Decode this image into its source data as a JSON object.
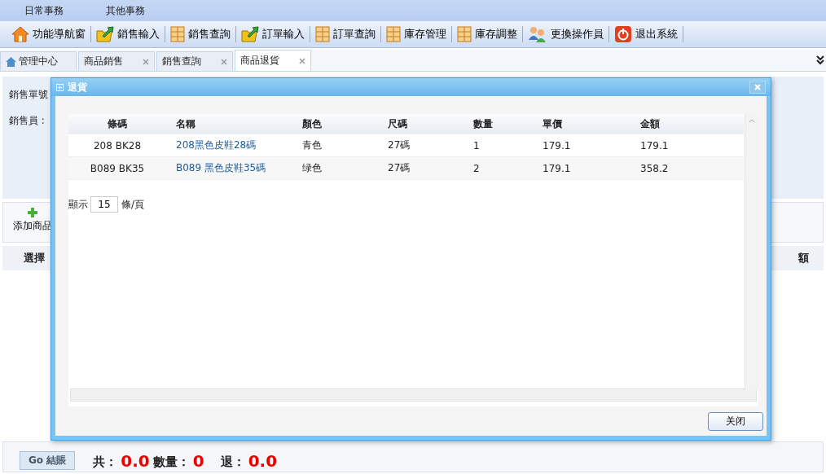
{
  "menu": [
    "日常事務",
    "其他事務"
  ],
  "toolbar": [
    {
      "label": "功能導航窗",
      "kind": "home"
    },
    {
      "label": "銷售輸入",
      "kind": "folder"
    },
    {
      "label": "銷售查詢",
      "kind": "grid"
    },
    {
      "label": "訂單輸入",
      "kind": "folder"
    },
    {
      "label": "訂單查詢",
      "kind": "grid"
    },
    {
      "label": "庫存管理",
      "kind": "grid"
    },
    {
      "label": "庫存調整",
      "kind": "grid"
    },
    {
      "label": "更換操作員",
      "kind": "users"
    },
    {
      "label": "退出系統",
      "kind": "power"
    }
  ],
  "tabs": [
    {
      "label": "管理中心",
      "kind": "home",
      "selected": false
    },
    {
      "label": "商品銷售",
      "kind": "closable",
      "selected": false
    },
    {
      "label": "銷售查詢",
      "kind": "closable",
      "selected": false
    },
    {
      "label": "商品退貨",
      "kind": "closable",
      "selected": true
    }
  ],
  "page": {
    "order_label": "銷售單號",
    "seller_label": "銷售員 :",
    "add_button": "添加商品",
    "col_first": "選擇",
    "col_last": "額",
    "checkout_button": "Go 結賬",
    "total_label": "共：",
    "total": "0.0",
    "qty_label": "數量：",
    "qty": "0",
    "return_label": "退：",
    "return_total": "0.0"
  },
  "dialog": {
    "title": "退貨",
    "columns": [
      "條碼",
      "名稱",
      "顏色",
      "尺碼",
      "數量",
      "單價",
      "金額"
    ],
    "rows": [
      [
        "208 BK28",
        "208黑色皮鞋28碼",
        "青色",
        "27碼",
        "1",
        "179.1",
        "179.1"
      ],
      [
        "B089 BK35",
        "B089 黑色皮鞋35碼",
        "绿色",
        "27碼",
        "2",
        "179.1",
        "358.2"
      ]
    ],
    "page_size_label": "顯示",
    "page_size": "15",
    "page_size_unit": "條/頁",
    "close_button": "关闭"
  }
}
